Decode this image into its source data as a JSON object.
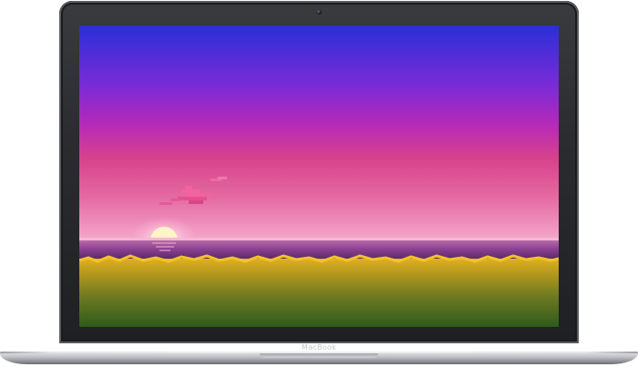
{
  "device": {
    "brand_label": "MacBook"
  },
  "wallpaper": {
    "colors": {
      "sky_top": "#2a2fd8",
      "sky_mid": "#9a2bd0",
      "sky_pink": "#d84a8c",
      "horizon": "#f08ab8",
      "sun": "#fff3c8",
      "water": "#7b3a8a",
      "grass_top": "#d8a81c",
      "grass_bottom": "#2f5a1c"
    }
  }
}
